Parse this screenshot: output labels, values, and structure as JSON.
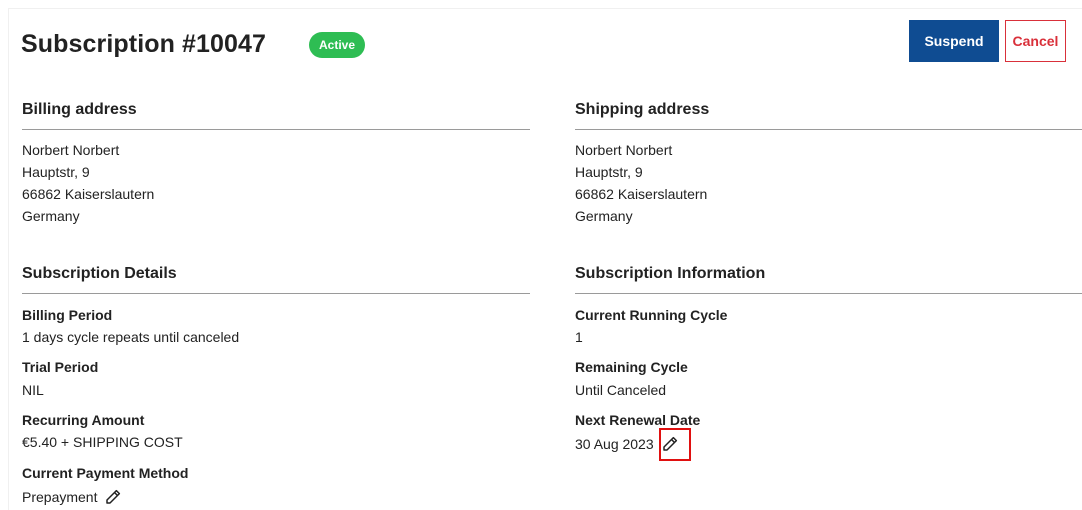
{
  "header": {
    "title": "Subscription #10047",
    "status_badge": "Active",
    "suspend_label": "Suspend",
    "cancel_label": "Cancel"
  },
  "billing_address": {
    "heading": "Billing address",
    "lines": [
      "Norbert Norbert",
      "Hauptstr, 9",
      "66862 Kaiserslautern",
      "Germany"
    ]
  },
  "shipping_address": {
    "heading": "Shipping address",
    "lines": [
      "Norbert Norbert",
      "Hauptstr, 9",
      "66862 Kaiserslautern",
      "Germany"
    ]
  },
  "subscription_details": {
    "heading": "Subscription Details",
    "billing_period_label": "Billing Period",
    "billing_period_value": "1 days cycle repeats until canceled",
    "trial_period_label": "Trial Period",
    "trial_period_value": "NIL",
    "recurring_amount_label": "Recurring Amount",
    "recurring_amount_value": "€5.40 + SHIPPING COST",
    "payment_method_label": "Current Payment Method",
    "payment_method_value": "Prepayment"
  },
  "subscription_information": {
    "heading": "Subscription Information",
    "current_cycle_label": "Current Running Cycle",
    "current_cycle_value": "1",
    "remaining_cycle_label": "Remaining Cycle",
    "remaining_cycle_value": "Until Canceled",
    "next_renewal_label": "Next Renewal Date",
    "next_renewal_value": "30 Aug 2023"
  },
  "colors": {
    "active_badge": "#2ebd53",
    "suspend_button": "#0f4c92",
    "cancel_button": "#d9303a",
    "highlight_box": "#e01010"
  },
  "icons": {
    "edit": "pencil-icon"
  }
}
